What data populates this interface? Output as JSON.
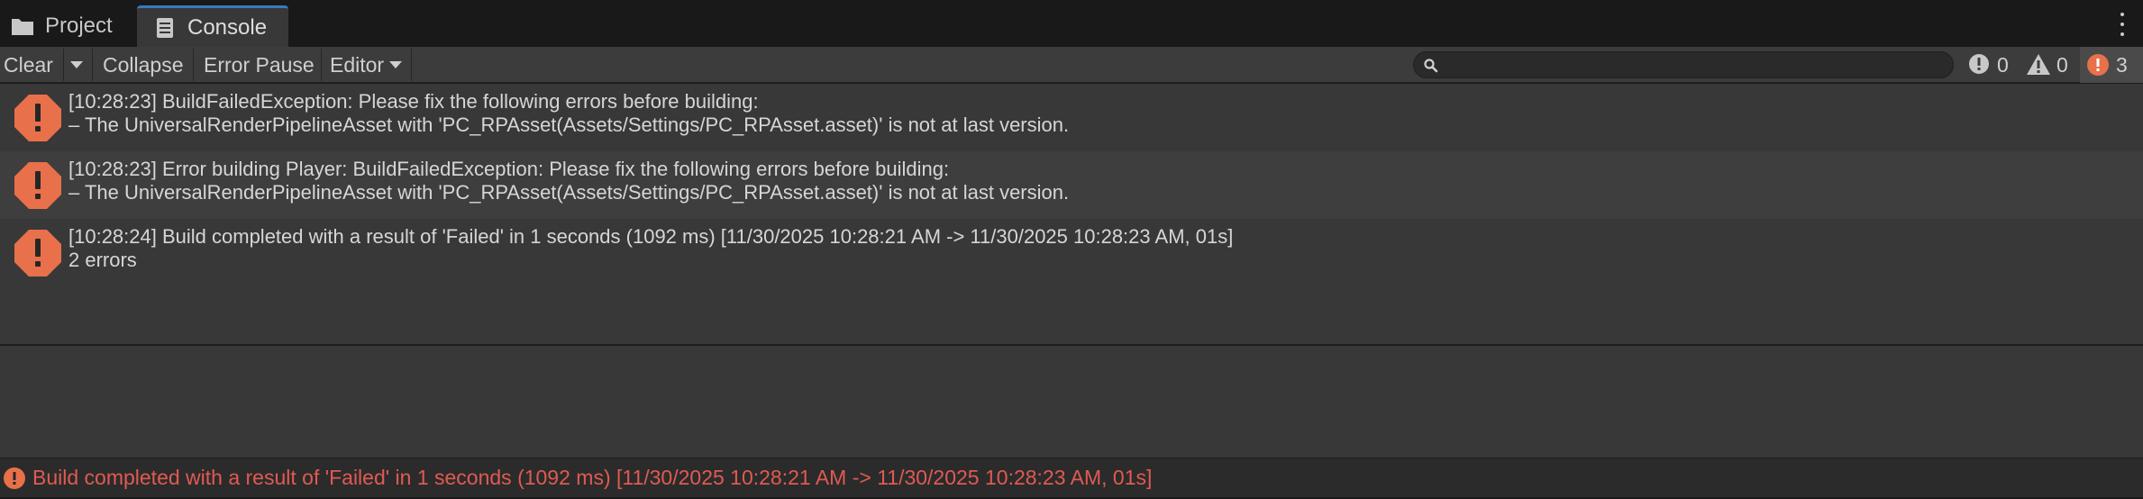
{
  "tabs": [
    {
      "label": "Project",
      "icon": "folder-icon"
    },
    {
      "label": "Console",
      "icon": "console-icon",
      "active": true
    }
  ],
  "toolbar": {
    "clear_label": "Clear",
    "collapse_label": "Collapse",
    "error_pause_label": "Error Pause",
    "editor_label": "Editor",
    "search_placeholder": "",
    "search_value": ""
  },
  "counters": {
    "info": "0",
    "warnings": "0",
    "errors": "3"
  },
  "logs": [
    {
      "line1": "[10:28:23] BuildFailedException: Please fix the following errors before building:",
      "line2": "– The UniversalRenderPipelineAsset with 'PC_RPAsset(Assets/Settings/PC_RPAsset.asset)' is not at last version."
    },
    {
      "line1": "[10:28:23] Error building Player: BuildFailedException: Please fix the following errors before building:",
      "line2": "– The UniversalRenderPipelineAsset with 'PC_RPAsset(Assets/Settings/PC_RPAsset.asset)' is not at last version."
    },
    {
      "line1": "[10:28:24] Build completed with a result of 'Failed' in 1 seconds (1092 ms) [11/30/2025 10:28:21 AM -> 11/30/2025 10:28:23 AM, 01s]",
      "line2": "2 errors"
    }
  ],
  "status": {
    "message": "Build completed with a result of 'Failed' in 1 seconds (1092 ms) [11/30/2025 10:28:21 AM -> 11/30/2025 10:28:23 AM, 01s]"
  },
  "colors": {
    "error": "#e8704a",
    "status_text": "#e05a52",
    "tab_accent": "#3a79bb"
  }
}
